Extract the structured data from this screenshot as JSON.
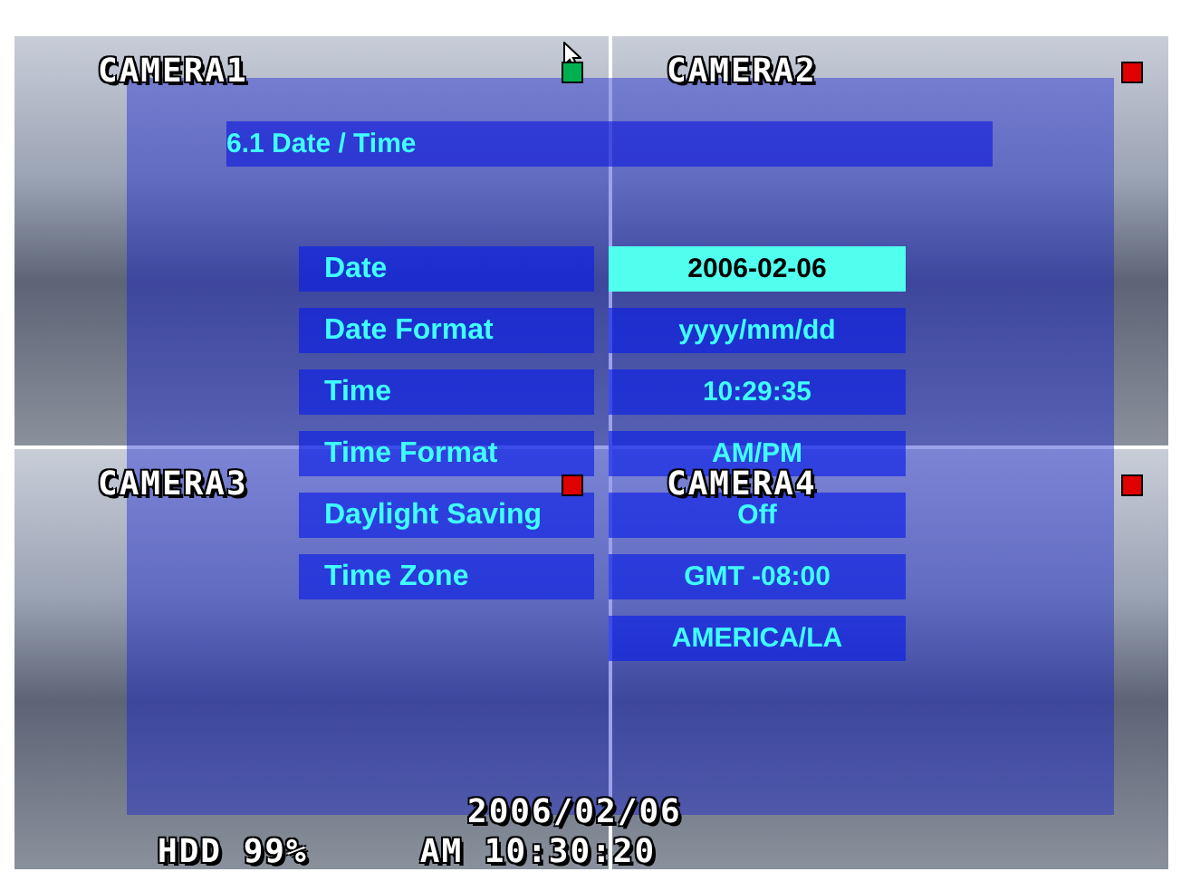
{
  "cameras": [
    {
      "name": "CAMERA1",
      "color": "#00b050"
    },
    {
      "name": "CAMERA2",
      "color": "#e00000"
    },
    {
      "name": "CAMERA3",
      "color": "#e00000"
    },
    {
      "name": "CAMERA4",
      "color": "#e00000"
    }
  ],
  "menu": {
    "title": "6.1 Date / Time",
    "rows": [
      {
        "label": "Date",
        "values": [
          "2006-02-06"
        ],
        "selected": true
      },
      {
        "label": "Date Format",
        "values": [
          "yyyy/mm/dd"
        ],
        "selected": false
      },
      {
        "label": "Time",
        "values": [
          "10:29:35"
        ],
        "selected": false
      },
      {
        "label": "Time Format",
        "values": [
          "AM/PM"
        ],
        "selected": false
      },
      {
        "label": "Daylight Saving",
        "values": [
          "Off"
        ],
        "selected": false
      },
      {
        "label": "Time Zone",
        "values": [
          "GMT  -08:00",
          "AMERICA/LA"
        ],
        "selected": false
      }
    ]
  },
  "status": {
    "date": "2006/02/06",
    "hdd": "HDD 99%",
    "time": "AM 10:30:20"
  }
}
